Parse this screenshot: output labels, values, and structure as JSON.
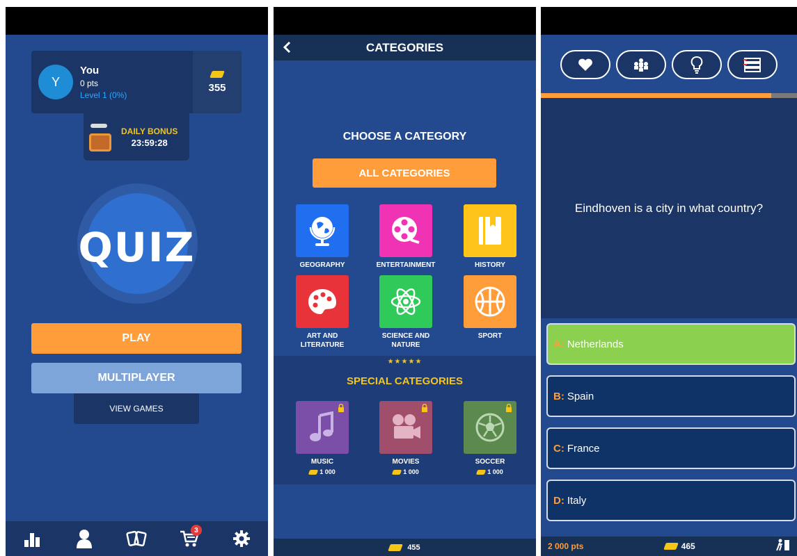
{
  "colors": {
    "background": "#234a8f",
    "panel": "#1a3566",
    "accent": "#ff9d3a",
    "gold": "#f5c518",
    "correct": "#8bd14f"
  },
  "home": {
    "profile": {
      "avatar_letter": "Y",
      "name": "You",
      "points": "0 pts",
      "level": "Level 1 (0%)"
    },
    "coins": "355",
    "daily_bonus": {
      "label": "DAILY BONUS",
      "timer": "23:59:28"
    },
    "logo": "QUIZ",
    "play_label": "PLAY",
    "multiplayer_label": "MULTIPLAYER",
    "view_games_label": "VIEW GAMES",
    "nav": {
      "icons": [
        "leaderboard-icon",
        "profile-icon",
        "cards-icon",
        "cart-icon",
        "settings-icon"
      ],
      "cart_badge": "3"
    }
  },
  "categories": {
    "title": "CATEGORIES",
    "choose_label": "CHOOSE A CATEGORY",
    "all_label": "ALL CATEGORIES",
    "items": [
      {
        "label": "GEOGRAPHY",
        "color": "#1f6ff0",
        "icon": "globe-icon"
      },
      {
        "label": "ENTERTAINMENT",
        "color": "#f032b4",
        "icon": "film-reel-icon"
      },
      {
        "label": "HISTORY",
        "color": "#ffc419",
        "icon": "book-icon"
      },
      {
        "label": "ART AND LITERATURE",
        "color": "#e8333a",
        "icon": "palette-icon"
      },
      {
        "label": "SCIENCE AND NATURE",
        "color": "#2fca5a",
        "icon": "atom-icon"
      },
      {
        "label": "SPORT",
        "color": "#ff9d3a",
        "icon": "basketball-icon"
      }
    ],
    "stars": "★★★★★",
    "special_title": "SPECIAL CATEGORIES",
    "special_items": [
      {
        "label": "MUSIC",
        "price": "1 000",
        "color": "#7b4fa8",
        "icon": "music-note-icon"
      },
      {
        "label": "MOVIES",
        "price": "1 000",
        "color": "#a14e6c",
        "icon": "movie-camera-icon"
      },
      {
        "label": "SOCCER",
        "price": "1 000",
        "color": "#5c8a4e",
        "icon": "soccer-ball-icon"
      }
    ],
    "coins": "455"
  },
  "question": {
    "lifelines": [
      "heart-icon",
      "audience-icon",
      "hint-bulb-icon",
      "question-list-icon"
    ],
    "progress": 0.9,
    "text": "Eindhoven is a city in what country?",
    "answers": [
      {
        "letter": "A:",
        "text": "Netherlands"
      },
      {
        "letter": "B:",
        "text": "Spain"
      },
      {
        "letter": "C:",
        "text": "France"
      },
      {
        "letter": "D:",
        "text": "Italy"
      }
    ],
    "points": "2 000 pts",
    "coins": "465"
  }
}
